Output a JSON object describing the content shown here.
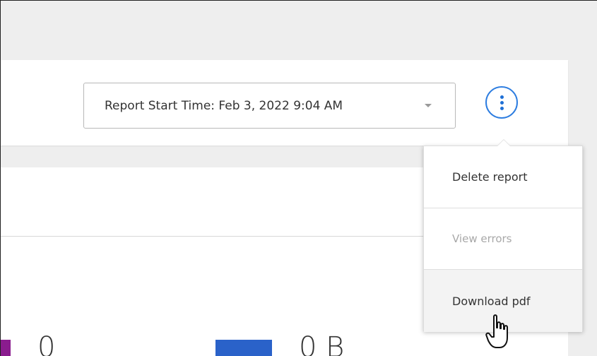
{
  "header": {
    "report_start_label": "Report Start Time: Feb 3, 2022 9:04 AM"
  },
  "menu": {
    "items": [
      {
        "label": "Delete report",
        "state": "enabled"
      },
      {
        "label": "View errors",
        "state": "disabled"
      },
      {
        "label": "Download pdf",
        "state": "hovered"
      }
    ]
  },
  "metrics": {
    "first_value": "0",
    "second_value": "0 B"
  },
  "colors": {
    "accent": "#2d7de0",
    "metric_a": "#8a1c8e",
    "metric_b": "#2a62c9"
  },
  "icons": {
    "more": "kebab-vertical-icon",
    "caret": "chevron-down-icon",
    "cursor": "hand-pointer-icon"
  }
}
